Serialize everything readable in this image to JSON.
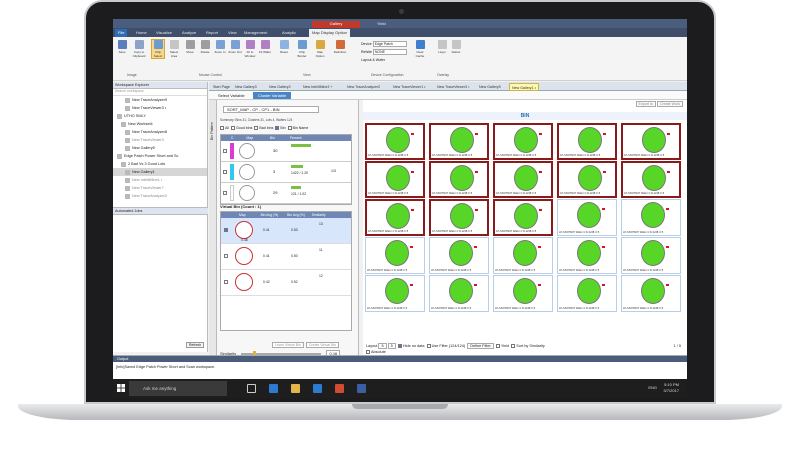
{
  "app": {
    "title": "Yield",
    "context_tab": "Gallery"
  },
  "ribbon_tabs": [
    "File",
    "Home",
    "Visualize",
    "Analyze",
    "Report",
    "View",
    "Management",
    "Analytic",
    "Map Display Option"
  ],
  "ribbon": {
    "buttons": [
      {
        "label": "Save",
        "icon": "save-icon"
      },
      {
        "label": "Copy to Clipboard",
        "icon": "clipboard-icon"
      },
      {
        "label": "Chip Select",
        "icon": "chip-select-icon",
        "selected": true
      },
      {
        "label": "Select Area",
        "icon": "select-area-icon"
      },
      {
        "label": "Move",
        "icon": "move-icon"
      },
      {
        "label": "Rotate",
        "icon": "rotate-icon"
      },
      {
        "label": "Zoom In",
        "icon": "zoom-in-icon"
      },
      {
        "label": "Zoom Out",
        "icon": "zoom-out-icon"
      },
      {
        "label": "Fit to Window",
        "icon": "fit-icon"
      },
      {
        "label": "Fit Wafer",
        "icon": "fit-wafer-icon"
      },
      {
        "label": "Reset",
        "icon": "reset-icon"
      },
      {
        "label": "Chip Border",
        "icon": "chip-border-icon"
      },
      {
        "label": "Map Option",
        "icon": "map-option-icon"
      },
      {
        "label": "Definition",
        "icon": "definition-icon"
      },
      {
        "label": "Clear Cache",
        "icon": "clear-cache-icon"
      },
      {
        "label": "Layer",
        "icon": "layer-icon"
      },
      {
        "label": "Defect",
        "icon": "defect-icon"
      }
    ],
    "groups": [
      "Image",
      "Mouse Control",
      "View",
      "Device Configuration",
      "Overlay"
    ],
    "device": {
      "label": "Device",
      "value": "Edge Patch",
      "refsite_label": "Refsite",
      "refsite_value": "NONE",
      "layout_label": "Layout & Wafer"
    }
  },
  "workspace": {
    "title": "Workspace Explorer",
    "search_placeholder": "Search workspace",
    "items": [
      {
        "label": "New TraceAnalyzer9",
        "style": "normal"
      },
      {
        "label": "New TraceViewer3 •",
        "style": "normal"
      },
      {
        "label": "UTHO SMLY",
        "style": "normal"
      },
      {
        "label": "New Workset4",
        "style": "normal"
      },
      {
        "label": "New TraceAnalyzer8",
        "style": "normal"
      },
      {
        "label": "New TraceViewer3",
        "style": "dim"
      },
      {
        "label": "New Gallery5",
        "style": "normal"
      },
      {
        "label": "Edge Patch Power Short and Sc",
        "style": "normal"
      },
      {
        "label": "2 Bad Vs 3 Good Lots",
        "style": "normal"
      },
      {
        "label": "New Gallery1",
        "style": "sel"
      },
      {
        "label": "New IntelliMine1 •",
        "style": "dim"
      },
      {
        "label": "New TraceViewer7",
        "style": "dim"
      },
      {
        "label": "New TraceAnalyzer2",
        "style": "dim"
      }
    ],
    "auto_jobs": "Automated Jobs",
    "refresh": "Refresh"
  },
  "doc_tabs": [
    "Start Page",
    "New Gallery3",
    "New Gallery2",
    "New IntelliMine3 +",
    "New TraceAnalyzer2",
    "New TraceViewer1 •",
    "New TraceViewer3 •",
    "New Gallery5",
    "New Gallery1 •"
  ],
  "crumbs": {
    "select": "Select Variable",
    "cluster": "Cluster Variable"
  },
  "side_label": "Bin Pattern",
  "controls": {
    "sort_value": "SORT_MAP - CP - CP1 - BIN",
    "summary": "Summary: Bins 31, Clusters 31, Lots 4, Wafers 124",
    "filters": [
      "All",
      "Good bins",
      "Bad bins",
      "Bin",
      "Bin Name"
    ],
    "headers": [
      "C",
      "Map",
      "Bin",
      "Percent"
    ],
    "bins": [
      {
        "color": "#d93cd3",
        "bin": "30",
        "pct": "",
        "sel": true
      },
      {
        "color": "#31c8ee",
        "bin": "3",
        "pct": "1422 / 1.20",
        "page": "1/3"
      },
      {
        "color": "#ffffff",
        "bin": "29",
        "pct": "121 / 1.02"
      }
    ],
    "virtual_title": "Virtual Bin (Count : 1)",
    "virt_headers": [
      "Map",
      "Bin Avg (%)",
      "Bin Avg (%)",
      "Similarity"
    ],
    "virt_rows": [
      {
        "a": "0.41",
        "b": "0.53",
        "c": "13",
        "sel": true,
        "tag": "0.48"
      },
      {
        "a": "0.41",
        "b": "0.50",
        "c": "11"
      },
      {
        "a": "0.42",
        "b": "0.52",
        "c": "12"
      }
    ],
    "learn_btn": "Learn Virtual Bin",
    "create_btn": "Create Virtual Bin",
    "similarity_label": "Similarity",
    "similarity_value": "0.16"
  },
  "gallery": {
    "title": "BIN",
    "header_btns": [
      "Export to",
      "Create Work"
    ],
    "wafer_label": "LP-SX678237 Wafer:1 Si:1248 C:5",
    "bottom": {
      "layout": "Layout",
      "cols": "5",
      "rows": "5",
      "hide_no_data": "Hide no data",
      "use_filter": "Use Filter (124/124)",
      "define_filter": "Define Filter",
      "yield": "Yield",
      "sort_similarity": "Sort by Similarity",
      "absolute": "Absolute",
      "pager": "1 / 5"
    }
  },
  "output": {
    "title": "Output",
    "line": "[Info]Saved Edge Patch Power Short and Scan workspace."
  },
  "taskbar": {
    "ask": "Ask me anything",
    "lang": "ENG",
    "time": "5:10 PM",
    "date": "3/7/2017"
  }
}
